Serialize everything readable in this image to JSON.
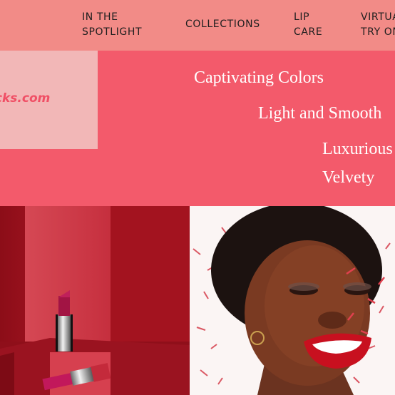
{
  "nav": {
    "items": [
      {
        "label": "IN THE\nSPOTLIGHT"
      },
      {
        "label": "COLLECTIONS"
      },
      {
        "label": "LIP\nCARE"
      },
      {
        "label": "VIRTUAL\nTRY ON"
      }
    ]
  },
  "logo": {
    "text": "Lipsticks.com"
  },
  "hero": {
    "taglines": [
      "Captivating Colors",
      "Light and Smooth",
      "Luxurious",
      "Velvety"
    ]
  },
  "photos": {
    "left": {
      "icon": "lipstick-product-photo"
    },
    "right": {
      "icon": "smiling-woman-red-lips-photo"
    }
  },
  "colors": {
    "nav_bg": "#f28b87",
    "hero_bg": "#f35a6b",
    "logo_bg": "#f2b7b7",
    "logo_text": "#f04f65"
  }
}
